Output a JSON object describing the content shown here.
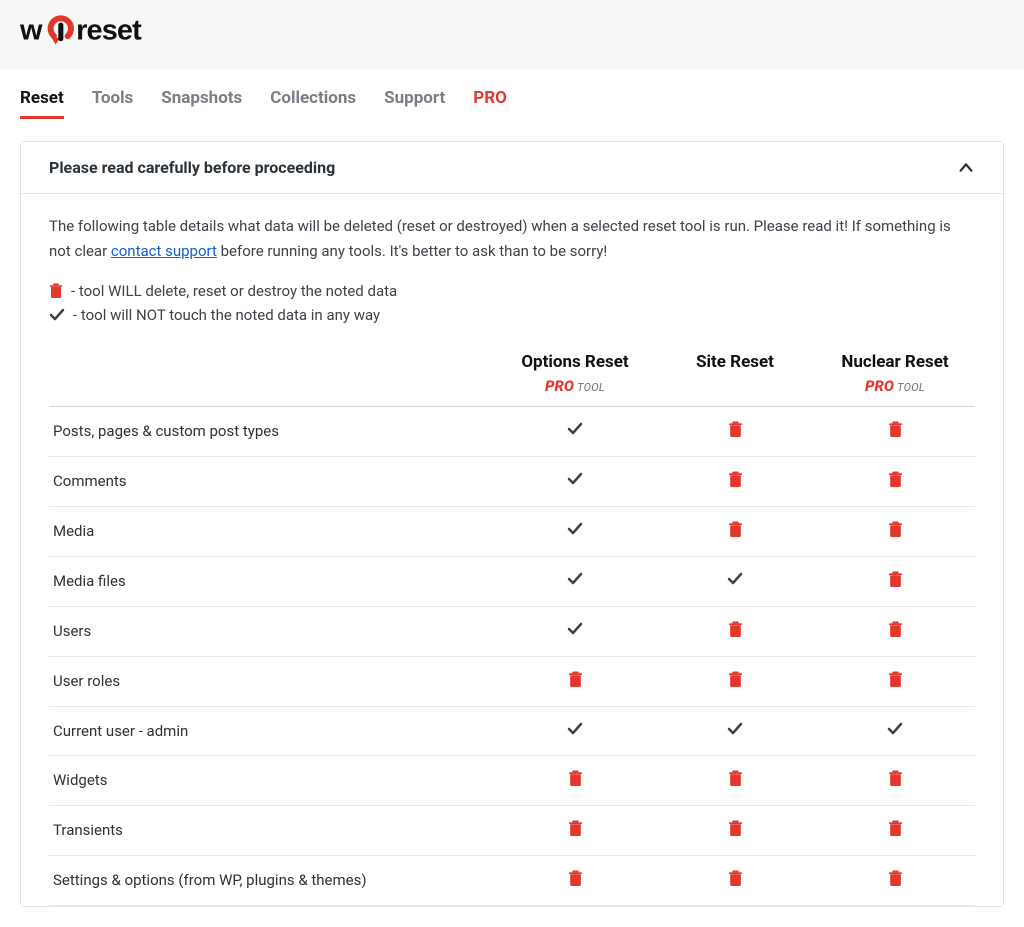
{
  "brand": "wpreset",
  "tabs": [
    {
      "label": "Reset",
      "active": true
    },
    {
      "label": "Tools"
    },
    {
      "label": "Snapshots"
    },
    {
      "label": "Collections"
    },
    {
      "label": "Support"
    },
    {
      "label": "PRO",
      "pro": true
    }
  ],
  "card": {
    "title": "Please read carefully before proceeding",
    "intro_pre": "The following table details what data will be deleted (reset or destroyed) when a selected reset tool is run. Please read it! If something is not clear ",
    "intro_link": "contact support",
    "intro_post": " before running any tools. It's better to ask than to be sorry!",
    "legend_delete": "- tool WILL delete, reset or destroy the noted data",
    "legend_keep": "- tool will NOT touch the noted data in any way"
  },
  "columns": [
    {
      "title": "Options Reset",
      "pro": true
    },
    {
      "title": "Site Reset",
      "pro": false
    },
    {
      "title": "Nuclear Reset",
      "pro": true
    }
  ],
  "pro_label": "PRO",
  "tool_label": "TOOL",
  "rows": [
    {
      "label": "Posts, pages & custom post types",
      "cells": [
        "check",
        "trash",
        "trash"
      ]
    },
    {
      "label": "Comments",
      "cells": [
        "check",
        "trash",
        "trash"
      ]
    },
    {
      "label": "Media",
      "cells": [
        "check",
        "trash",
        "trash"
      ]
    },
    {
      "label": "Media files",
      "cells": [
        "check",
        "check",
        "trash"
      ]
    },
    {
      "label": "Users",
      "cells": [
        "check",
        "trash",
        "trash"
      ]
    },
    {
      "label": "User roles",
      "cells": [
        "trash",
        "trash",
        "trash"
      ]
    },
    {
      "label": "Current user - admin",
      "cells": [
        "check",
        "check",
        "check"
      ]
    },
    {
      "label": "Widgets",
      "cells": [
        "trash",
        "trash",
        "trash"
      ]
    },
    {
      "label": "Transients",
      "cells": [
        "trash",
        "trash",
        "trash"
      ]
    },
    {
      "label": "Settings & options (from WP, plugins & themes)",
      "cells": [
        "trash",
        "trash",
        "trash"
      ]
    }
  ]
}
